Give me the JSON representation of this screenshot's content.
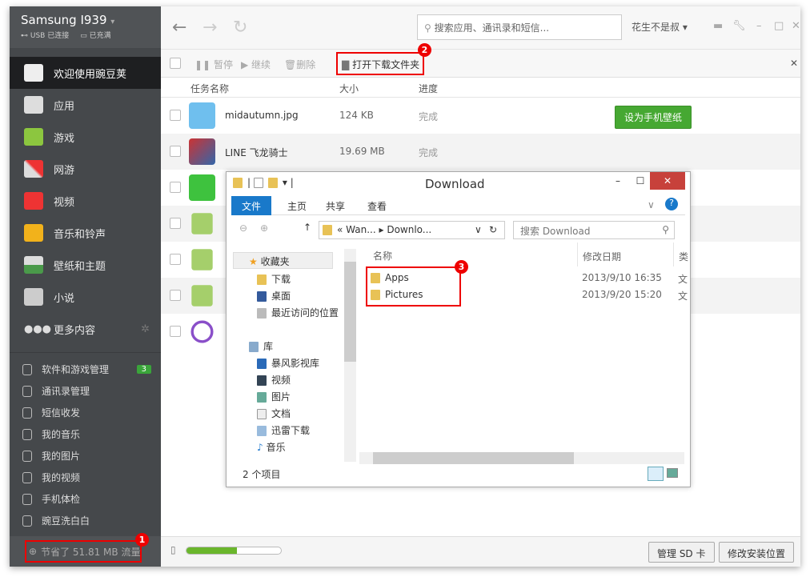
{
  "sidebar": {
    "device": "Samsung I939",
    "usb": "USB 已连接",
    "battery": "已充满",
    "nav": [
      {
        "label": "欢迎使用豌豆荚",
        "icon": "house-icon"
      },
      {
        "label": "应用",
        "icon": "toolbox-icon"
      },
      {
        "label": "游戏",
        "icon": "gamepad-icon"
      },
      {
        "label": "网游",
        "icon": "swords-icon"
      },
      {
        "label": "视频",
        "icon": "play-icon"
      },
      {
        "label": "音乐和铃声",
        "icon": "music-icon"
      },
      {
        "label": "壁纸和主题",
        "icon": "picture-icon"
      },
      {
        "label": "小说",
        "icon": "book-icon"
      },
      {
        "label": "更多内容",
        "icon": "dots-icon"
      }
    ],
    "tools": [
      {
        "label": "软件和游戏管理",
        "badge": "3"
      },
      {
        "label": "通讯录管理"
      },
      {
        "label": "短信收发"
      },
      {
        "label": "我的音乐"
      },
      {
        "label": "我的图片"
      },
      {
        "label": "我的视频"
      },
      {
        "label": "手机体检"
      },
      {
        "label": "豌豆洗白白"
      }
    ],
    "footer": "节省了 51.81 MB 流量"
  },
  "header": {
    "search_placeholder": "搜索应用、通讯录和短信...",
    "user": "花生不是叔"
  },
  "toolbar": {
    "pause": "暂停",
    "resume": "继续",
    "delete": "删除",
    "open_folder": "打开下载文件夹"
  },
  "table": {
    "columns": [
      "任务名称",
      "大小",
      "进度"
    ],
    "rows": [
      {
        "name": "midautumn.jpg",
        "size": "124 KB",
        "status": "完成",
        "action": "设为手机壁纸"
      },
      {
        "name": "LINE 飞龙骑士",
        "size": "19.69 MB",
        "status": "完成"
      },
      {
        "name": ""
      },
      {
        "name": ""
      },
      {
        "name": ""
      },
      {
        "name": ""
      },
      {
        "name": ""
      }
    ]
  },
  "bottom": {
    "storage_fraction": 0.53,
    "manage_sd": "管理 SD 卡",
    "change_location": "修改安装位置"
  },
  "callouts": [
    "1",
    "2",
    "3"
  ],
  "explorer": {
    "title": "Download",
    "tabs": [
      "文件",
      "主页",
      "共享",
      "查看"
    ],
    "path": [
      "«",
      "Wan...",
      "Downlo..."
    ],
    "search_placeholder": "搜索 Download",
    "tree": [
      {
        "label": "收藏夹",
        "level": 0
      },
      {
        "label": "下载",
        "level": 1
      },
      {
        "label": "桌面",
        "level": 1
      },
      {
        "label": "最近访问的位置",
        "level": 1
      },
      {
        "label": "库",
        "level": 0
      },
      {
        "label": "暴风影视库",
        "level": 1
      },
      {
        "label": "视频",
        "level": 1
      },
      {
        "label": "图片",
        "level": 1
      },
      {
        "label": "文档",
        "level": 1
      },
      {
        "label": "迅雷下载",
        "level": 1
      },
      {
        "label": "音乐",
        "level": 1
      }
    ],
    "columns": [
      "名称",
      "修改日期",
      "类"
    ],
    "files": [
      {
        "name": "Apps",
        "date": "2013/9/10 16:35",
        "type": "文"
      },
      {
        "name": "Pictures",
        "date": "2013/9/20 15:20",
        "type": "文"
      }
    ],
    "status": "2 个项目"
  }
}
